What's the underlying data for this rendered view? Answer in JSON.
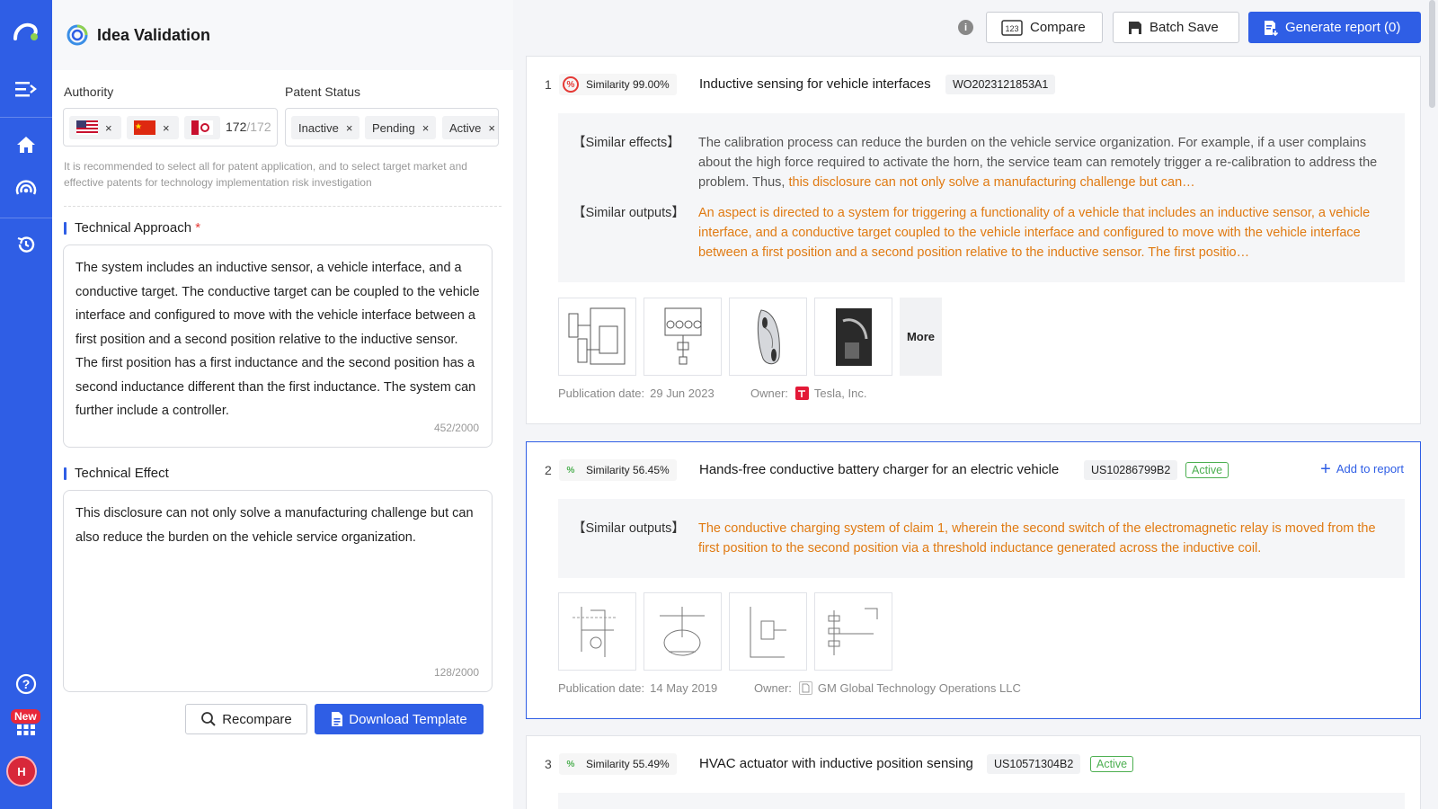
{
  "app": {
    "title": "Idea Validation"
  },
  "rail": {
    "new_badge": "New",
    "avatar_initial": "H"
  },
  "authority": {
    "label": "Authority",
    "count_selected": "172",
    "count_total": "/172",
    "remove_glyph": "×"
  },
  "patent_status": {
    "label": "Patent Status",
    "chips": [
      "Inactive",
      "Pending",
      "Active"
    ]
  },
  "hint": "It is recommended to select all for patent application, and to select target market and effective patents for technology implementation risk investigation",
  "technical_approach": {
    "label": "Technical Approach",
    "required_mark": "*",
    "text": "The system includes an inductive sensor, a vehicle interface, and a conductive target. The conductive target can be coupled to the vehicle interface and configured to move with the vehicle interface between a first position and a second position relative to the inductive sensor. The first position has a first inductance and the second position has a second inductance different than the first inductance. The system can further include a controller.",
    "counter": "452/2000"
  },
  "technical_effect": {
    "label": "Technical Effect",
    "text": "This disclosure can not only solve a manufacturing challenge but can also reduce the burden on the vehicle service organization.",
    "counter": "128/2000"
  },
  "actions": {
    "recompare": "Recompare",
    "download_template": "Download Template"
  },
  "toolbar": {
    "compare": "Compare",
    "batch_save": "Batch Save",
    "generate_report": "Generate report (0)",
    "info": "i"
  },
  "results": [
    {
      "rank": "1",
      "similarity": "Similarity 99.00%",
      "title": "Inductive sensing for vehicle interfaces",
      "number": "WO2023121853A1",
      "effects_label": "【Similar effects】",
      "effects_text": "The calibration process can reduce the burden on the vehicle service organization. For example, if a user complains about the high force required to activate the horn, the service team can remotely trigger a re-calibration to address the problem. Thus,",
      "effects_highlight": " this disclosure can not only solve a manufacturing challenge but can…",
      "outputs_label": "【Similar outputs】",
      "outputs_text": "An aspect is directed to a system for triggering a functionality of a vehicle that includes an inductive sensor, a vehicle interface, and a conductive target coupled to the vehicle interface and configured to move with the vehicle interface between a first position and a second position relative to the inductive sensor. The first positio…",
      "more": "More",
      "pub_label": "Publication date:",
      "pub_date": "29 Jun 2023",
      "owner_label": "Owner:",
      "owner": "Tesla, Inc."
    },
    {
      "rank": "2",
      "similarity": "Similarity 56.45%",
      "title": "Hands-free conductive battery charger for an electric vehicle",
      "number": "US10286799B2",
      "status": "Active",
      "add_to_report": "Add to report",
      "outputs_label": "【Similar outputs】",
      "outputs_text": "The conductive charging system of claim 1, wherein the second switch of the electromagnetic relay is moved from the first position to the second position via a threshold inductance generated across the inductive coil.",
      "pub_label": "Publication date:",
      "pub_date": "14 May 2019",
      "owner_label": "Owner:",
      "owner": "GM Global Technology Operations LLC"
    },
    {
      "rank": "3",
      "similarity": "Similarity 55.49%",
      "title": "HVAC actuator with inductive position sensing",
      "number": "US10571304B2",
      "status": "Active"
    }
  ],
  "colors": {
    "brand": "#2f5ee5",
    "highlight": "#e07a12",
    "active": "#4caf50"
  }
}
